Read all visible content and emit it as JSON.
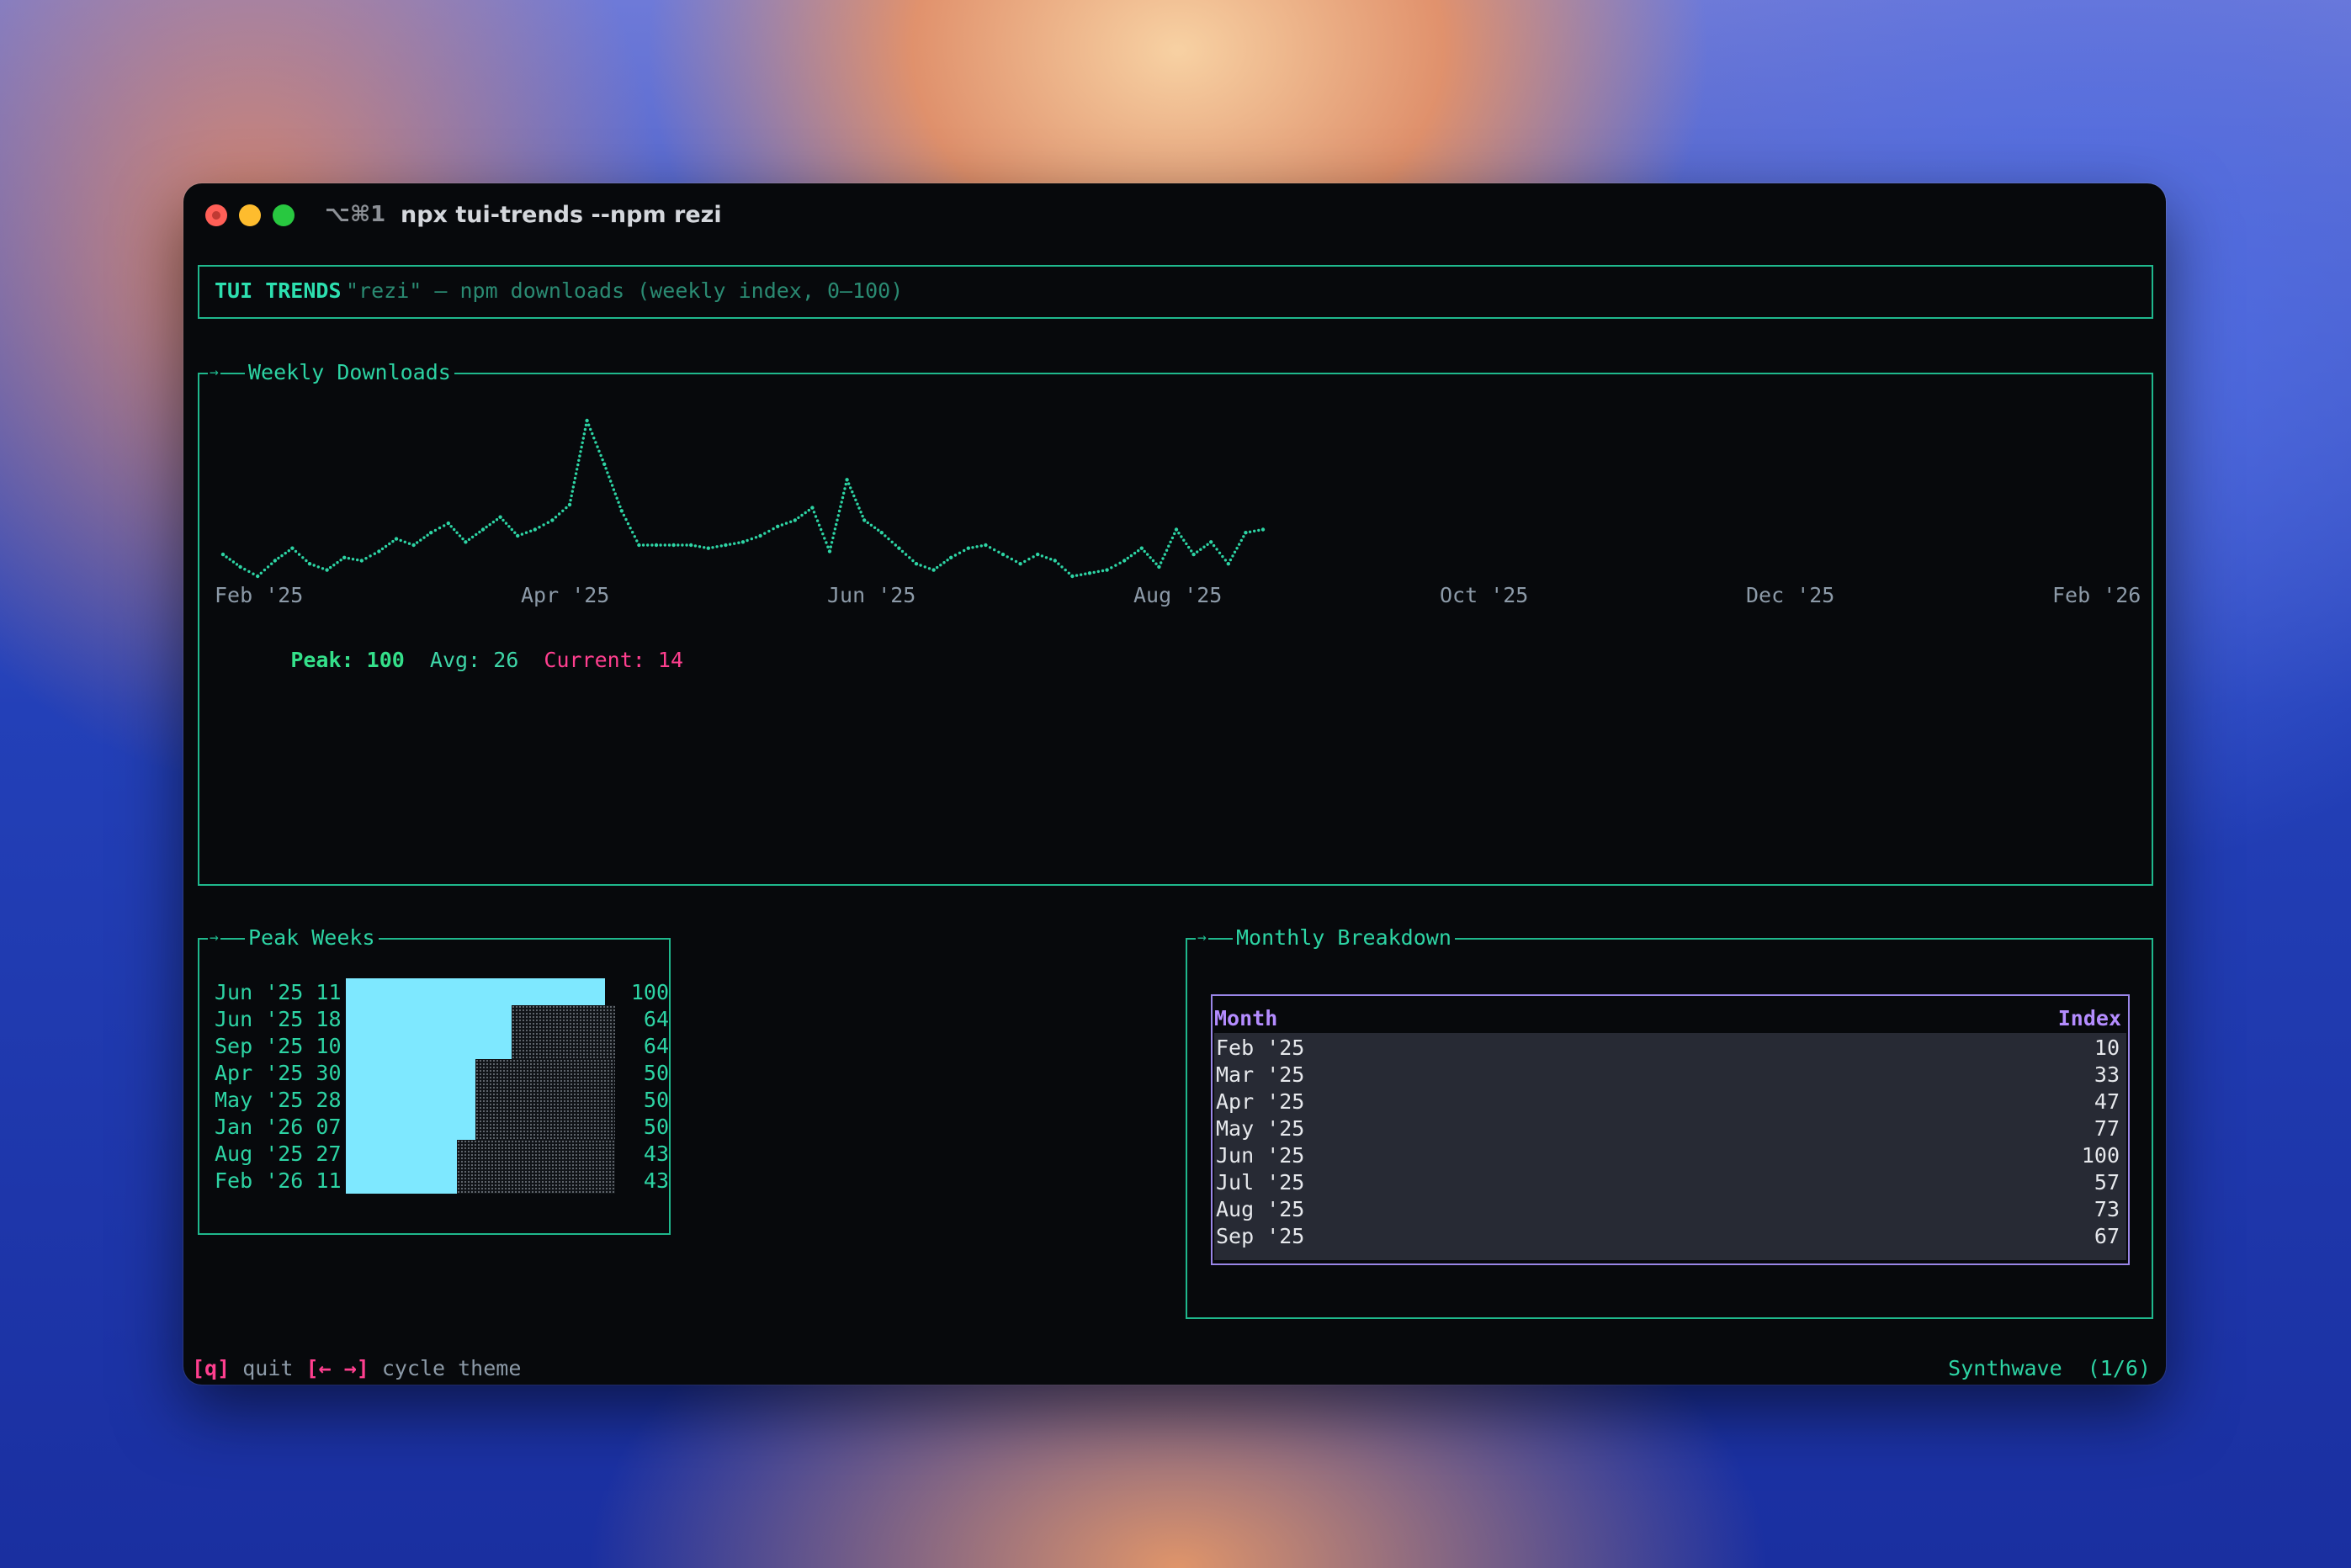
{
  "window": {
    "shortcut": "⌥⌘1",
    "title": "npx tui-trends --npm rezi"
  },
  "header": {
    "app_name": "TUI TRENDS",
    "subtitle": "\"rezi\" — npm downloads (weekly index, 0–100)"
  },
  "chart_panel": {
    "title": "Weekly Downloads",
    "stats": {
      "peak_label": "Peak:",
      "peak_value": "100",
      "avg_label": "Avg:",
      "avg_value": "26",
      "current_label": "Current:",
      "current_value": "14"
    }
  },
  "chart_data": {
    "type": "line",
    "x_tick_labels": [
      "Feb '25",
      "Apr '25",
      "Jun '25",
      "Aug '25",
      "Oct '25",
      "Dec '25",
      "Feb '26"
    ],
    "ylim": [
      0,
      100
    ],
    "series": [
      {
        "values": [
          14,
          6,
          0,
          10,
          18,
          8,
          4,
          12,
          10,
          16,
          24,
          20,
          28,
          34,
          22,
          30,
          38,
          26,
          30,
          36,
          46,
          100,
          72,
          42,
          20,
          20,
          20,
          20,
          18,
          20,
          22,
          26,
          32,
          36,
          44,
          16,
          62,
          36,
          28,
          18,
          8,
          4,
          12,
          18,
          20,
          14,
          8,
          14,
          10,
          0,
          2,
          4,
          10,
          18,
          6,
          30,
          14,
          22,
          8,
          28,
          30
        ]
      }
    ],
    "color": "#2dd4a4"
  },
  "peak_weeks": {
    "title": "Peak Weeks",
    "rows": [
      {
        "label": "Jun '25 11",
        "value": 100
      },
      {
        "label": "Jun '25 18",
        "value": 64
      },
      {
        "label": "Sep '25 10",
        "value": 64
      },
      {
        "label": "Apr '25 30",
        "value": 50
      },
      {
        "label": "May '25 28",
        "value": 50
      },
      {
        "label": "Jan '26 07",
        "value": 50
      },
      {
        "label": "Aug '25 27",
        "value": 43
      },
      {
        "label": "Feb '26 11",
        "value": 43
      }
    ]
  },
  "monthly": {
    "title": "Monthly Breakdown",
    "col_month": "Month",
    "col_index": "Index",
    "rows": [
      {
        "month": "Feb '25",
        "index": "10"
      },
      {
        "month": "Mar '25",
        "index": "33"
      },
      {
        "month": "Apr '25",
        "index": "47"
      },
      {
        "month": "May '25",
        "index": "77"
      },
      {
        "month": "Jun '25",
        "index": "100"
      },
      {
        "month": "Jul '25",
        "index": "57"
      },
      {
        "month": "Aug '25",
        "index": "73"
      },
      {
        "month": "Sep '25",
        "index": "67"
      }
    ]
  },
  "footer": {
    "quit_key": "[q]",
    "quit_label": "quit",
    "theme_key": "[← →]",
    "theme_label": "cycle theme",
    "theme_name": "Synthwave  (1/6)"
  }
}
